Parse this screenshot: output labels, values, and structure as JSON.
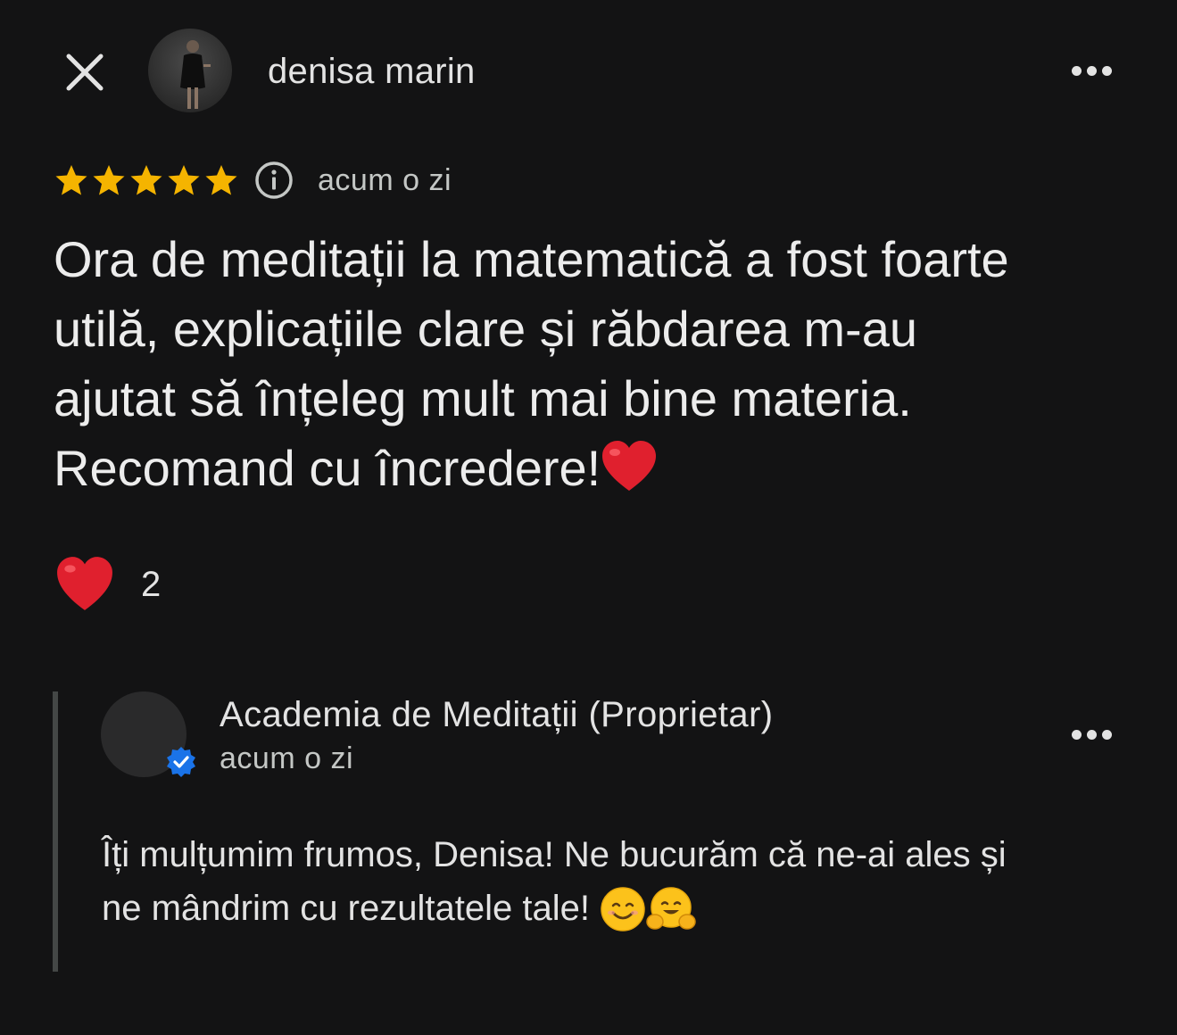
{
  "header": {
    "close_icon": "close-icon",
    "user_name": "denisa marin",
    "more_icon": "more-horizontal-icon"
  },
  "review": {
    "rating": 5,
    "rating_max": 5,
    "star_color": "#f5b400",
    "info_icon": "info-icon",
    "time": "acum o zi",
    "text_line_1": "Ora de meditații la matematică a fost foarte",
    "text_line_2": "utilă, explicațiile clare și răbdarea  m-au",
    "text_line_3": "ajutat să înțeleg mult mai bine materia.",
    "text_line_4": "Recomand cu încredere!",
    "text_emoji": "red-heart-emoji"
  },
  "reaction": {
    "icon": "red-heart-emoji",
    "count": "2"
  },
  "owner_reply": {
    "name": "Academia de Meditații (Proprietar)",
    "time": "acum o zi",
    "verified_icon": "verified-badge-icon",
    "badge_color": "#1a73e8",
    "text_line_1": "Îți mulțumim frumos, Denisa! Ne bucurăm că ne-ai ales și",
    "text_line_2": "ne mândrim cu rezultatele tale! ",
    "emoji_1": "smiling-face-emoji",
    "emoji_2": "hugging-face-emoji"
  }
}
